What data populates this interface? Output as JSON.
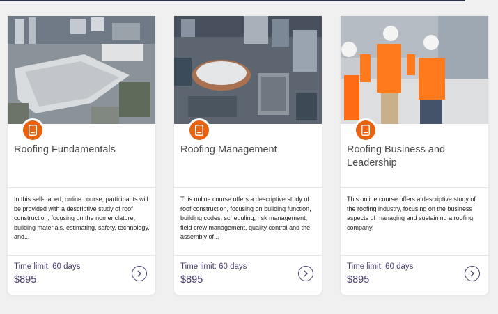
{
  "colors": {
    "accent": "#e8620f",
    "text_purple": "#4a3d6b",
    "background": "#f0f0f1"
  },
  "courses": [
    {
      "image": "aerial-photo-convention-center",
      "icon": "book-icon",
      "title": "Roofing Fundamentals",
      "description": "In this self-paced, online course, participants will be provided with a descriptive study of roof construction, focusing on the nomenclature, building materials, estimating, safety, technology, and...",
      "time_limit": "Time limit: 60 days",
      "price": "$895",
      "action_icon": "chevron-right-icon"
    },
    {
      "image": "aerial-photo-arena",
      "icon": "book-icon",
      "title": "Roofing Management",
      "description": "This online course offers a descriptive study of roof construction, focusing on building function, building codes, scheduling, risk management, field crew management, quality control and the assembly of...",
      "time_limit": "Time limit: 60 days",
      "price": "$895",
      "action_icon": "chevron-right-icon"
    },
    {
      "image": "photo-workers-on-roof",
      "icon": "book-icon",
      "title": "Roofing Business and Leadership",
      "description": "This online course offers a descriptive study of the roofing industry, focusing on the business aspects of managing and sustaining a roofing company.",
      "time_limit": "Time limit: 60 days",
      "price": "$895",
      "action_icon": "chevron-right-icon"
    }
  ]
}
